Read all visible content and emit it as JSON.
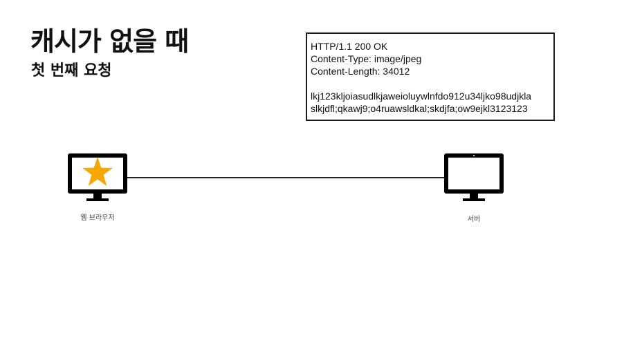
{
  "slide": {
    "title": "캐시가 없을 때",
    "subtitle": "첫 번째 요청"
  },
  "response": {
    "status_line": "HTTP/1.1 200 OK",
    "content_type": "Content-Type: image/jpeg",
    "content_length": "Content-Length: 34012",
    "body_line_1": "lkj123kljoiasudlkjaweioluywlnfdo912u34ljko98udjkla",
    "body_line_2": "slkjdfl;qkawj9;o4ruawsldkal;skdjfa;ow9ejkl3123123"
  },
  "client": {
    "label": "웹 브라우저",
    "icon": "monitor-with-star-icon"
  },
  "server": {
    "label": "서버",
    "icon": "monitor-icon"
  },
  "colors": {
    "star": "#F5A800",
    "monitor": "#000000",
    "line": "#222222"
  }
}
